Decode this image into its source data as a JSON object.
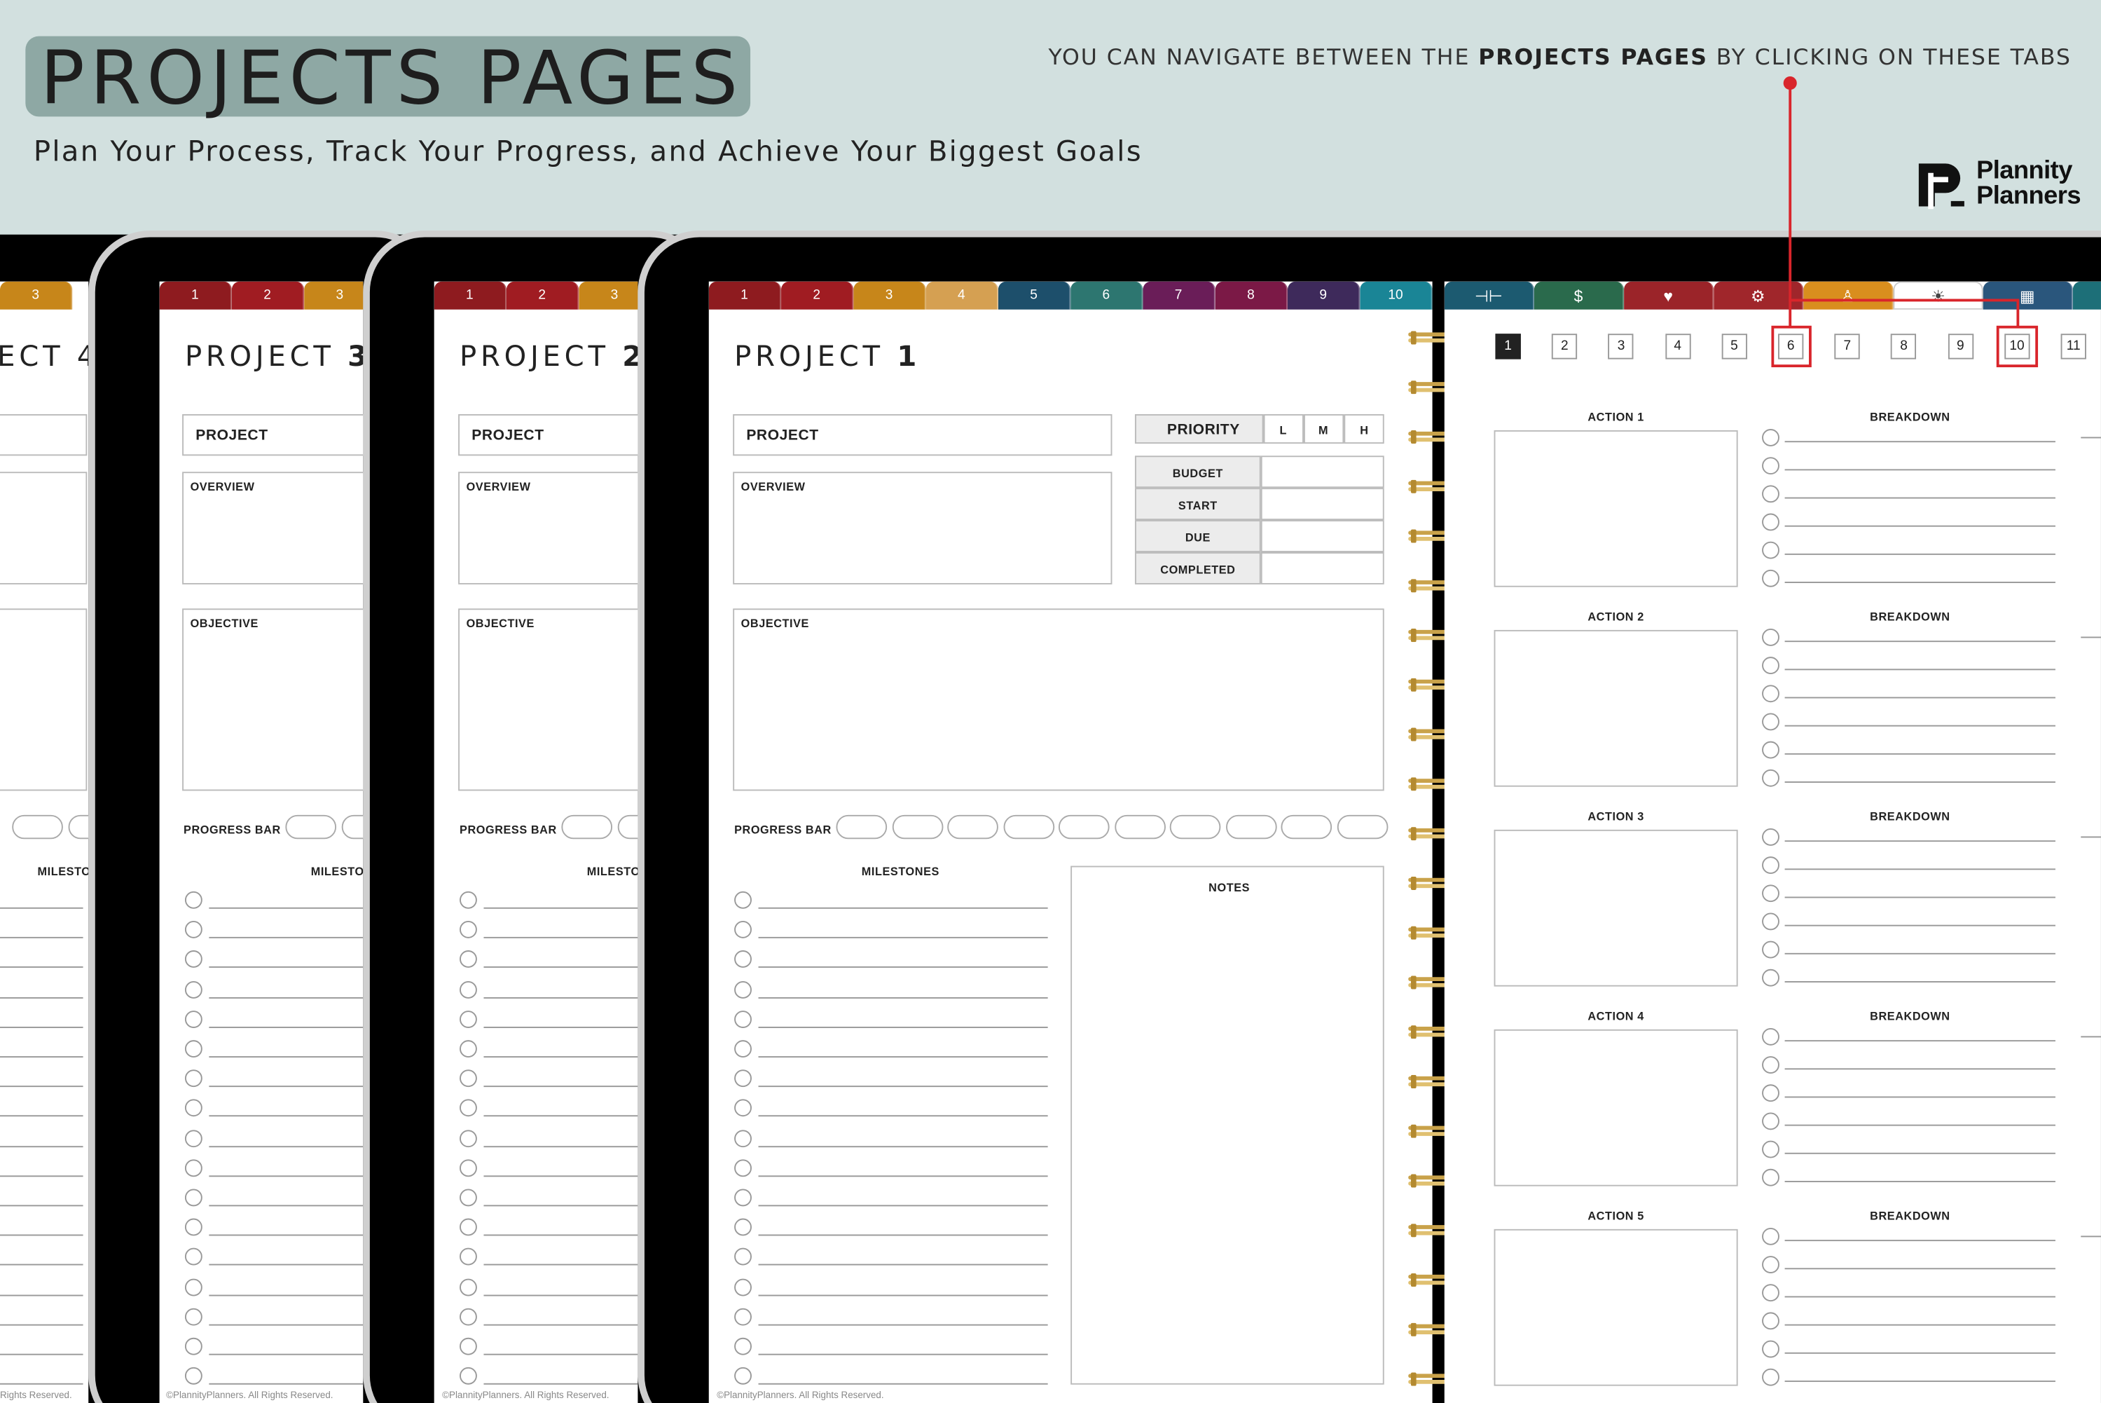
{
  "header": {
    "title": "PROJECTS PAGES",
    "subtitle": "Plan Your Process, Track Your Progress, and Achieve Your Biggest Goals",
    "nav_hint_pre": "YOU CAN NAVIGATE BETWEEN THE ",
    "nav_hint_bold": "PROJECTS PAGES",
    "nav_hint_post": " BY CLICKING ON THESE TABS",
    "logo_line1": "Plannity",
    "logo_line2": "Planners"
  },
  "colors": {
    "background": "#d2e0df",
    "title_pill": "#8ea8a4",
    "highlight_red": "#d9252b",
    "tab_colors": [
      "#8e1b1f",
      "#a01c22",
      "#c7861a",
      "#d5a052",
      "#1d4f6b",
      "#2d7670",
      "#6a1d58",
      "#7b1946",
      "#3e2a5b",
      "#1a8596"
    ],
    "icon_tab_colors": [
      "#1c5a70",
      "#2a6a4c",
      "#9b2429",
      "#a0262b",
      "#d98e1e",
      "#ffffff",
      "#2a567c",
      "#1d6f78"
    ]
  },
  "project_tabs": [
    "1",
    "2",
    "3",
    "4",
    "5",
    "6",
    "7",
    "8",
    "9",
    "10"
  ],
  "icon_tabs": [
    "dumbbell-icon",
    "dollar-icon",
    "heart-icon",
    "gear-icon",
    "person-icon",
    "lightbulb-icon",
    "calendar-icon",
    "more-icon"
  ],
  "page_numbers": [
    "1",
    "2",
    "3",
    "4",
    "5",
    "6",
    "7",
    "8",
    "9",
    "10",
    "11"
  ],
  "selected_page": "1",
  "highlighted_pages": [
    "6",
    "10"
  ],
  "back_pages": [
    {
      "title_pre": "PROJECT ",
      "title_num": "4",
      "title_visible": "ECT 4"
    },
    {
      "title_pre": "PROJECT ",
      "title_num": "3"
    },
    {
      "title_pre": "PROJECT ",
      "title_num": "2"
    }
  ],
  "main_page": {
    "title_pre": "PROJECT ",
    "title_num": "1",
    "project_label": "PROJECT",
    "overview_label": "OVERVIEW",
    "objective_label": "OBJECTIVE",
    "priority_label": "PRIORITY",
    "priority_options": [
      "L",
      "M",
      "H"
    ],
    "details": [
      "BUDGET",
      "START",
      "DUE",
      "COMPLETED"
    ],
    "progress_label": "PROGRESS BAR",
    "progress_steps": 10,
    "milestones_label": "MILESTONES",
    "milestone_count": 17,
    "notes_label": "NOTES",
    "copyright": "©PlannityPlanners. All Rights Reserved."
  },
  "back_labels": {
    "project": "PROJECT",
    "overview": "OVERVIEW",
    "objective": "OBJECTIVE",
    "progress": "PROGRESS BAR",
    "milestones_clip": "MILESTO",
    "milestones_clip4": "MILESTO",
    "copyright": "©PlannityPlanners. All Rights Reserved.",
    "copyright_clip": "Rights Reserved."
  },
  "right_page": {
    "actions": [
      "ACTION 1",
      "ACTION 2",
      "ACTION 3",
      "ACTION 4",
      "ACTION 5"
    ],
    "breakdown_label": "BREAKDOWN",
    "breakdown_items": 6
  }
}
